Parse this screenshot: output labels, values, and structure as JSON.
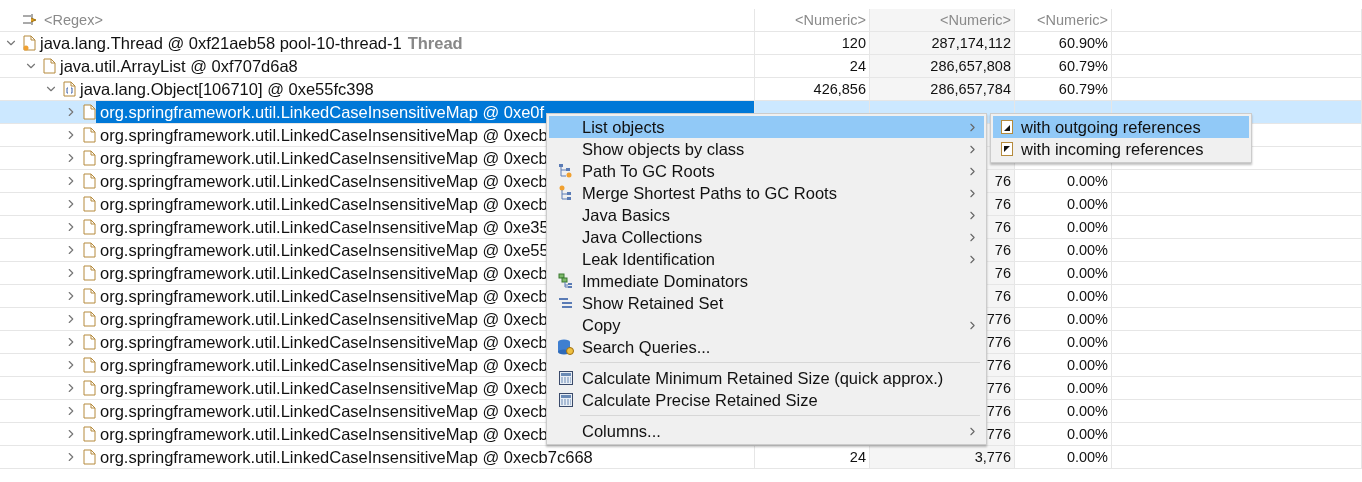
{
  "filters": {
    "name": "<Regex>",
    "shallow": "<Numeric>",
    "retained": "<Numeric>",
    "percentage": "<Numeric>"
  },
  "rows": [
    {
      "kind": "thread",
      "name": "java.lang.Thread @ 0xf21aeb58  pool-10-thread-1",
      "label": "Thread",
      "shallow": "120",
      "retained": "287,174,112",
      "percentage": "60.90%",
      "expanded": true,
      "selected": false,
      "children": [
        {
          "kind": "object",
          "name": "java.util.ArrayList @ 0xf707d6a8",
          "shallow": "24",
          "retained": "286,657,808",
          "percentage": "60.79%",
          "expanded": true,
          "selected": false,
          "children": [
            {
              "kind": "array",
              "name": "java.lang.Object[106710] @ 0xe55fc398",
              "shallow": "426,856",
              "retained": "286,657,784",
              "percentage": "60.79%",
              "expanded": true,
              "selected": false,
              "children": [
                {
                  "kind": "object",
                  "name": "org.springframework.util.LinkedCaseInsensitiveMap @ 0xe0f",
                  "expanded": false,
                  "selected": true
                },
                {
                  "kind": "object",
                  "name": "org.springframework.util.LinkedCaseInsensitiveMap @ 0xecb",
                  "expanded": false,
                  "selected": false
                },
                {
                  "kind": "object",
                  "name": "org.springframework.util.LinkedCaseInsensitiveMap @ 0xecb",
                  "expanded": false,
                  "selected": false
                },
                {
                  "kind": "object",
                  "name": "org.springframework.util.LinkedCaseInsensitiveMap @ 0xecb",
                  "retained": "76",
                  "percentage": "0.00%",
                  "expanded": false,
                  "selected": false
                },
                {
                  "kind": "object",
                  "name": "org.springframework.util.LinkedCaseInsensitiveMap @ 0xecb",
                  "retained": "76",
                  "percentage": "0.00%",
                  "expanded": false,
                  "selected": false
                },
                {
                  "kind": "object",
                  "name": "org.springframework.util.LinkedCaseInsensitiveMap @ 0xe35",
                  "retained": "76",
                  "percentage": "0.00%",
                  "expanded": false,
                  "selected": false
                },
                {
                  "kind": "object",
                  "name": "org.springframework.util.LinkedCaseInsensitiveMap @ 0xe55",
                  "retained": "76",
                  "percentage": "0.00%",
                  "expanded": false,
                  "selected": false
                },
                {
                  "kind": "object",
                  "name": "org.springframework.util.LinkedCaseInsensitiveMap @ 0xecb",
                  "retained": "76",
                  "percentage": "0.00%",
                  "expanded": false,
                  "selected": false
                },
                {
                  "kind": "object",
                  "name": "org.springframework.util.LinkedCaseInsensitiveMap @ 0xecb",
                  "retained": "76",
                  "percentage": "0.00%",
                  "expanded": false,
                  "selected": false
                },
                {
                  "kind": "object",
                  "name": "org.springframework.util.LinkedCaseInsensitiveMap @ 0xecb",
                  "retained": "776",
                  "percentage": "0.00%",
                  "expanded": false,
                  "selected": false
                },
                {
                  "kind": "object",
                  "name": "org.springframework.util.LinkedCaseInsensitiveMap @ 0xecb",
                  "retained": "776",
                  "percentage": "0.00%",
                  "expanded": false,
                  "selected": false
                },
                {
                  "kind": "object",
                  "name": "org.springframework.util.LinkedCaseInsensitiveMap @ 0xecb",
                  "retained": "776",
                  "percentage": "0.00%",
                  "expanded": false,
                  "selected": false
                },
                {
                  "kind": "object",
                  "name": "org.springframework.util.LinkedCaseInsensitiveMap @ 0xecb",
                  "retained": "776",
                  "percentage": "0.00%",
                  "expanded": false,
                  "selected": false
                },
                {
                  "kind": "object",
                  "name": "org.springframework.util.LinkedCaseInsensitiveMap @ 0xecb",
                  "retained": "776",
                  "percentage": "0.00%",
                  "expanded": false,
                  "selected": false
                },
                {
                  "kind": "object",
                  "name": "org.springframework.util.LinkedCaseInsensitiveMap @ 0xecb",
                  "retained": "776",
                  "percentage": "0.00%",
                  "expanded": false,
                  "selected": false
                },
                {
                  "kind": "object",
                  "name": "org.springframework.util.LinkedCaseInsensitiveMap @ 0xecb7c668",
                  "shallow": "24",
                  "retained": "3,776",
                  "percentage": "0.00%",
                  "expanded": false,
                  "selected": false
                }
              ]
            }
          ]
        }
      ]
    }
  ],
  "context_menu": {
    "items": [
      {
        "kind": "plain",
        "label": "List objects",
        "submenu": true,
        "selected": true
      },
      {
        "kind": "plain",
        "label": "Show objects by class",
        "submenu": true,
        "selected": false
      },
      {
        "kind": "path",
        "label": "Path To GC Roots",
        "submenu": true,
        "selected": false
      },
      {
        "kind": "merge",
        "label": "Merge Shortest Paths to GC Roots",
        "submenu": true,
        "selected": false
      },
      {
        "kind": "plain",
        "label": "Java Basics",
        "submenu": true,
        "selected": false
      },
      {
        "kind": "plain",
        "label": "Java Collections",
        "submenu": true,
        "selected": false
      },
      {
        "kind": "plain",
        "label": "Leak Identification",
        "submenu": true,
        "selected": false
      },
      {
        "kind": "dominators",
        "label": "Immediate Dominators",
        "submenu": false,
        "selected": false
      },
      {
        "kind": "retained",
        "label": "Show Retained Set",
        "submenu": false,
        "selected": false
      },
      {
        "kind": "plain",
        "label": "Copy",
        "submenu": true,
        "selected": false
      },
      {
        "kind": "query",
        "label": "Search Queries...",
        "submenu": false,
        "selected": false
      },
      {
        "kind": "separator"
      },
      {
        "kind": "calc",
        "label": "Calculate Minimum Retained Size (quick approx.)",
        "submenu": false,
        "selected": false
      },
      {
        "kind": "calc",
        "label": "Calculate Precise Retained Size",
        "submenu": false,
        "selected": false
      },
      {
        "kind": "separator"
      },
      {
        "kind": "plain",
        "label": "Columns...",
        "submenu": true,
        "selected": false
      }
    ]
  },
  "submenu": {
    "items": [
      {
        "kind": "outgoing",
        "label": "with outgoing references",
        "selected": true
      },
      {
        "kind": "incoming",
        "label": "with incoming references",
        "selected": false
      }
    ]
  }
}
